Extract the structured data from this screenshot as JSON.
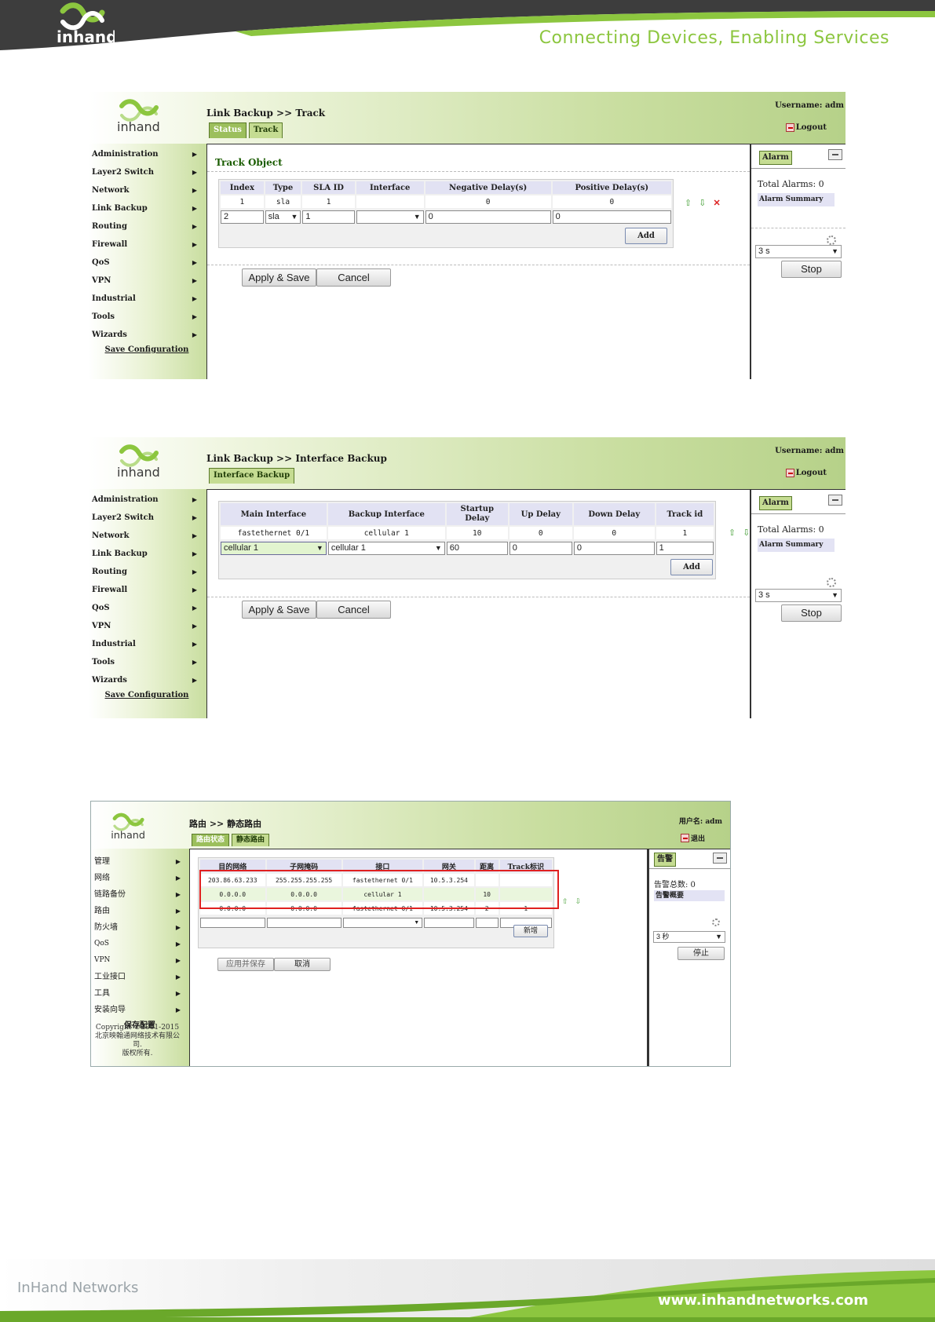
{
  "document": {
    "slogan": "Connecting Devices, Enabling Services",
    "footer_company": "InHand Networks",
    "footer_url": "www.inhandnetworks.com"
  },
  "shot1": {
    "breadcrumb": "Link Backup >> Track",
    "tabs": [
      "Status",
      "Track"
    ],
    "username": "Username: adm",
    "logout": "Logout",
    "menu": [
      "Administration",
      "Layer2 Switch",
      "Network",
      "Link Backup",
      "Routing",
      "Firewall",
      "QoS",
      "VPN",
      "Industrial",
      "Tools",
      "Wizards"
    ],
    "save_config": "Save Configuration",
    "section_title": "Track Object",
    "table": {
      "headers": [
        "Index",
        "Type",
        "SLA ID",
        "Interface",
        "Negative Delay(s)",
        "Positive Delay(s)"
      ],
      "row": [
        "1",
        "sla",
        "1",
        "",
        "0",
        "0"
      ],
      "inputs": {
        "index": "2",
        "type": "sla",
        "sla_id": "1",
        "interface": "",
        "negative": "0",
        "positive": "0"
      }
    },
    "add": "Add",
    "apply": "Apply & Save",
    "cancel": "Cancel",
    "alarm_tab": "Alarm",
    "total_alarms": "Total Alarms: 0",
    "alarm_summary": "Alarm Summary",
    "interval": "3 s",
    "stop": "Stop"
  },
  "shot2": {
    "breadcrumb": "Link Backup >> Interface Backup",
    "tabs": [
      "Interface Backup"
    ],
    "username": "Username: adm",
    "logout": "Logout",
    "menu": [
      "Administration",
      "Layer2 Switch",
      "Network",
      "Link Backup",
      "Routing",
      "Firewall",
      "QoS",
      "VPN",
      "Industrial",
      "Tools",
      "Wizards"
    ],
    "save_config": "Save Configuration",
    "table": {
      "headers": [
        "Main Interface",
        "Backup Interface",
        "Startup Delay",
        "Up Delay",
        "Down Delay",
        "Track id"
      ],
      "row": [
        "fastethernet 0/1",
        "cellular 1",
        "10",
        "0",
        "0",
        "1"
      ],
      "inputs": {
        "main": "cellular 1",
        "backup": "cellular 1",
        "startup": "60",
        "up": "0",
        "down": "0",
        "track": "1"
      }
    },
    "add": "Add",
    "apply": "Apply & Save",
    "cancel": "Cancel",
    "alarm_tab": "Alarm",
    "total_alarms": "Total Alarms: 0",
    "alarm_summary": "Alarm Summary",
    "interval": "3 s",
    "stop": "Stop"
  },
  "shot3": {
    "breadcrumb": "路由 >> 静态路由",
    "tabs": [
      "路由状态",
      "静态路由"
    ],
    "username": "用户名: adm",
    "logout": "退出",
    "menu": [
      "管理",
      "网络",
      "链路备份",
      "路由",
      "防火墙",
      "QoS",
      "VPN",
      "工业接口",
      "工具",
      "安装向导"
    ],
    "save_config": "保存配置",
    "copyright": [
      "Copyright ©2001-2015",
      "北京映翰通网络技术有限公",
      "司.",
      "版权所有."
    ],
    "table": {
      "headers": [
        "目的网络",
        "子网掩码",
        "接口",
        "网关",
        "距离",
        "Track标识"
      ],
      "rows": [
        [
          "203.86.63.233",
          "255.255.255.255",
          "fastethernet 0/1",
          "10.5.3.254",
          "",
          ""
        ],
        [
          "0.0.0.0",
          "0.0.0.0",
          "cellular 1",
          "",
          "10",
          ""
        ],
        [
          "0.0.0.0",
          "0.0.0.0",
          "fastethernet 0/1",
          "10.5.3.254",
          "2",
          "1"
        ]
      ]
    },
    "add": "新增",
    "apply": "应用并保存",
    "cancel": "取消",
    "alarm_tab": "告警",
    "total_alarms": "告警总数: 0",
    "alarm_summary": "告警概要",
    "interval": "3 秒",
    "stop": "停止"
  },
  "colors": {
    "brand_green": "#8cc63f",
    "header_dark": "#3a3a3a",
    "nav_green": "#c9dea0",
    "title_green": "#1a5c00",
    "highlight_red": "#e02020"
  }
}
